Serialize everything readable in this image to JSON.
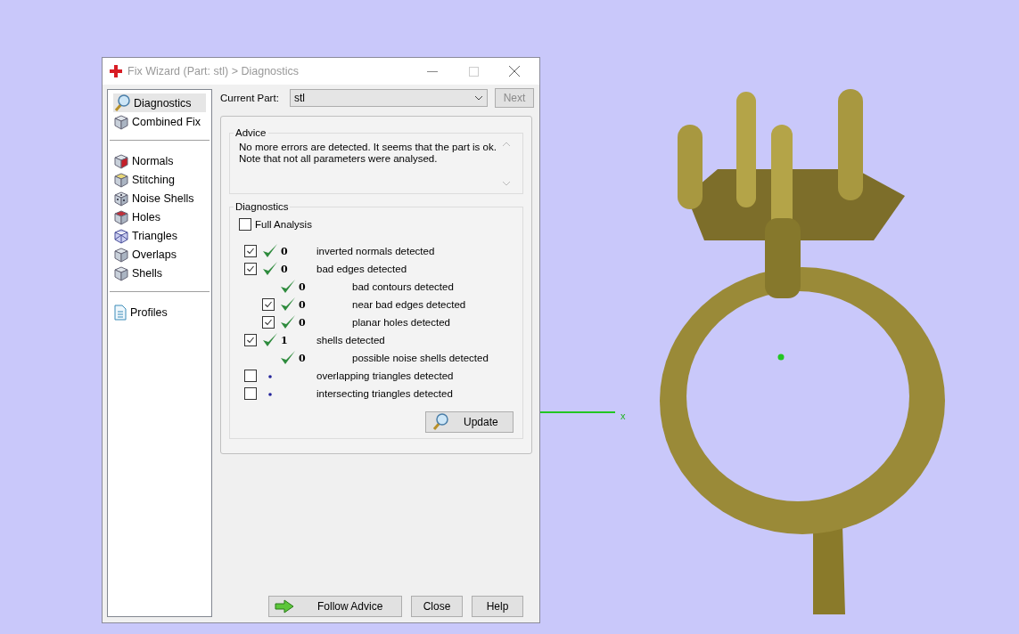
{
  "window": {
    "title": "Fix Wizard (Part: stl) > Diagnostics"
  },
  "sidebar": {
    "groups": [
      [
        {
          "label": "Diagnostics",
          "selected": true
        },
        {
          "label": "Combined Fix",
          "selected": false
        }
      ],
      [
        {
          "label": "Normals",
          "selected": false
        },
        {
          "label": "Stitching",
          "selected": false
        },
        {
          "label": "Noise Shells",
          "selected": false
        },
        {
          "label": "Holes",
          "selected": false
        },
        {
          "label": "Triangles",
          "selected": false
        },
        {
          "label": "Overlaps",
          "selected": false
        },
        {
          "label": "Shells",
          "selected": false
        }
      ],
      [
        {
          "label": "Profiles",
          "selected": false
        }
      ]
    ]
  },
  "current_part": {
    "label": "Current Part:",
    "value": "stl",
    "next_button": "Next"
  },
  "advice": {
    "title": "Advice",
    "text": "No more errors are detected. It seems that the part is ok.\nNote that not all parameters were analysed."
  },
  "diagnostics": {
    "title": "Diagnostics",
    "full_analysis": {
      "label": "Full Analysis",
      "checked": false
    },
    "items": [
      {
        "kind": "ok",
        "checked": true,
        "count": "0",
        "label": "inverted normals detected"
      },
      {
        "kind": "ok",
        "checked": true,
        "count": "0",
        "label": "bad edges detected",
        "children": [
          {
            "kind": "ok",
            "count": "0",
            "label": "bad contours detected"
          },
          {
            "kind": "ok",
            "checked": true,
            "count": "0",
            "label": "near bad edges detected"
          },
          {
            "kind": "ok",
            "checked": true,
            "count": "0",
            "label": "planar holes detected"
          }
        ]
      },
      {
        "kind": "ok",
        "checked": true,
        "count": "1",
        "label": "shells detected",
        "children": [
          {
            "kind": "ok",
            "count": "0",
            "label": "possible noise shells detected"
          }
        ]
      },
      {
        "kind": "pending",
        "checked": false,
        "label": "overlapping triangles detected"
      },
      {
        "kind": "pending",
        "checked": false,
        "label": "intersecting triangles detected"
      }
    ],
    "update_button": "Update"
  },
  "buttons": [
    {
      "label": "Follow Advice",
      "kind": "advice"
    },
    {
      "label": "Close",
      "kind": "plain"
    },
    {
      "label": "Help",
      "kind": "plain"
    }
  ],
  "viewport": {
    "axis_label": "x"
  }
}
